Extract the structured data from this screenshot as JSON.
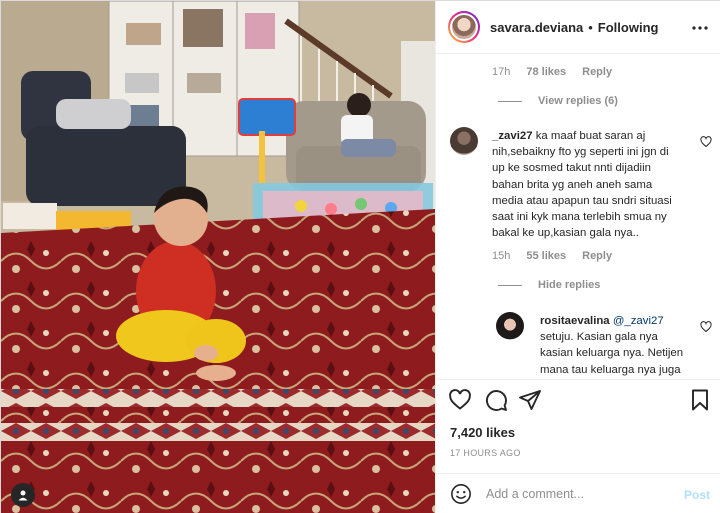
{
  "post": {
    "username": "savara.deviana",
    "separator": "•",
    "follow_status": "Following"
  },
  "comments": {
    "first_meta": {
      "time": "17h",
      "likes": "78 likes",
      "reply": "Reply"
    },
    "view_replies": "View replies (6)",
    "second": {
      "username": "_zavi27",
      "text": "ka maaf buat saran aj nih,sebaikny fto yg seperti ini jgn di up ke sosmed takut nnti dijadiin bahan brita yg aneh aneh sama media atau apapun tau sndri situasi saat ini kyk mana terlebih smua ny bakal ke up,kasian gala nya..",
      "time": "15h",
      "likes": "55 likes",
      "reply": "Reply"
    },
    "hide_replies": "Hide replies",
    "reply": {
      "username": "rositaevalina",
      "mention": "@_zavi27",
      "text": "setuju. Kasian gala nya kasian keluarga nya. Netijen mana tau keluarga nya juga"
    }
  },
  "stats": {
    "likes": "7,420 likes",
    "timestamp": "17 HOURS AGO"
  },
  "composer": {
    "placeholder": "Add a comment...",
    "post_label": "Post"
  },
  "colors": {
    "link_blue": "#00376b",
    "post_disabled": "#b2dffc",
    "muted": "#8e8e8e",
    "rug_red": "#8e1c1f"
  },
  "icons": {
    "more": "more-options-icon",
    "like": "heart-icon",
    "comment": "comment-bubble-icon",
    "share": "paper-plane-icon",
    "save": "bookmark-icon",
    "emoji": "smiley-icon",
    "tagged": "user-tag-icon"
  }
}
